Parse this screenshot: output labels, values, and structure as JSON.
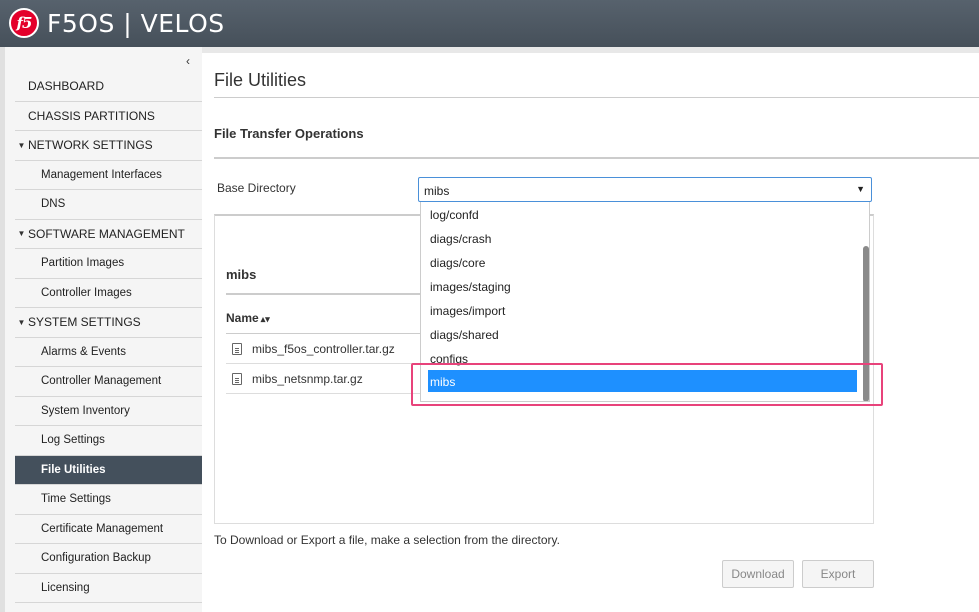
{
  "app": {
    "logo": "f5",
    "title": "F5OS | VELOS"
  },
  "sidebar": {
    "collapse_icon": "‹",
    "items": [
      {
        "label": "DASHBOARD",
        "type": "top"
      },
      {
        "label": "CHASSIS PARTITIONS",
        "type": "top"
      },
      {
        "label": "NETWORK SETTINGS",
        "type": "group"
      },
      {
        "label": "Management Interfaces",
        "type": "sub"
      },
      {
        "label": "DNS",
        "type": "sub"
      },
      {
        "label": "SOFTWARE MANAGEMENT",
        "type": "group"
      },
      {
        "label": "Partition Images",
        "type": "sub"
      },
      {
        "label": "Controller Images",
        "type": "sub"
      },
      {
        "label": "SYSTEM SETTINGS",
        "type": "group"
      },
      {
        "label": "Alarms & Events",
        "type": "sub"
      },
      {
        "label": "Controller Management",
        "type": "sub"
      },
      {
        "label": "System Inventory",
        "type": "sub"
      },
      {
        "label": "Log Settings",
        "type": "sub"
      },
      {
        "label": "File Utilities",
        "type": "sub",
        "active": true
      },
      {
        "label": "Time Settings",
        "type": "sub"
      },
      {
        "label": "Certificate Management",
        "type": "sub"
      },
      {
        "label": "Configuration Backup",
        "type": "sub"
      },
      {
        "label": "Licensing",
        "type": "sub"
      }
    ]
  },
  "main": {
    "page_title": "File Utilities",
    "section_title": "File Transfer Operations",
    "base_directory_label": "Base Directory",
    "base_directory_value": "mibs",
    "directory_title": "mibs",
    "column_name": "Name",
    "files": [
      "mibs_f5os_controller.tar.gz",
      "mibs_netsnmp.tar.gz"
    ],
    "hint": "To Download or Export a file, make a selection from the directory.",
    "download_label": "Download",
    "export_label": "Export"
  },
  "dropdown": {
    "options": [
      "log/confd",
      "diags/crash",
      "diags/core",
      "images/staging",
      "images/import",
      "diags/shared",
      "configs",
      "mibs"
    ],
    "selected": "mibs"
  },
  "colors": {
    "accent": "#1e90ff",
    "active_nav": "#44505c",
    "highlight": "#e8437b",
    "brand": "#e4002b"
  }
}
